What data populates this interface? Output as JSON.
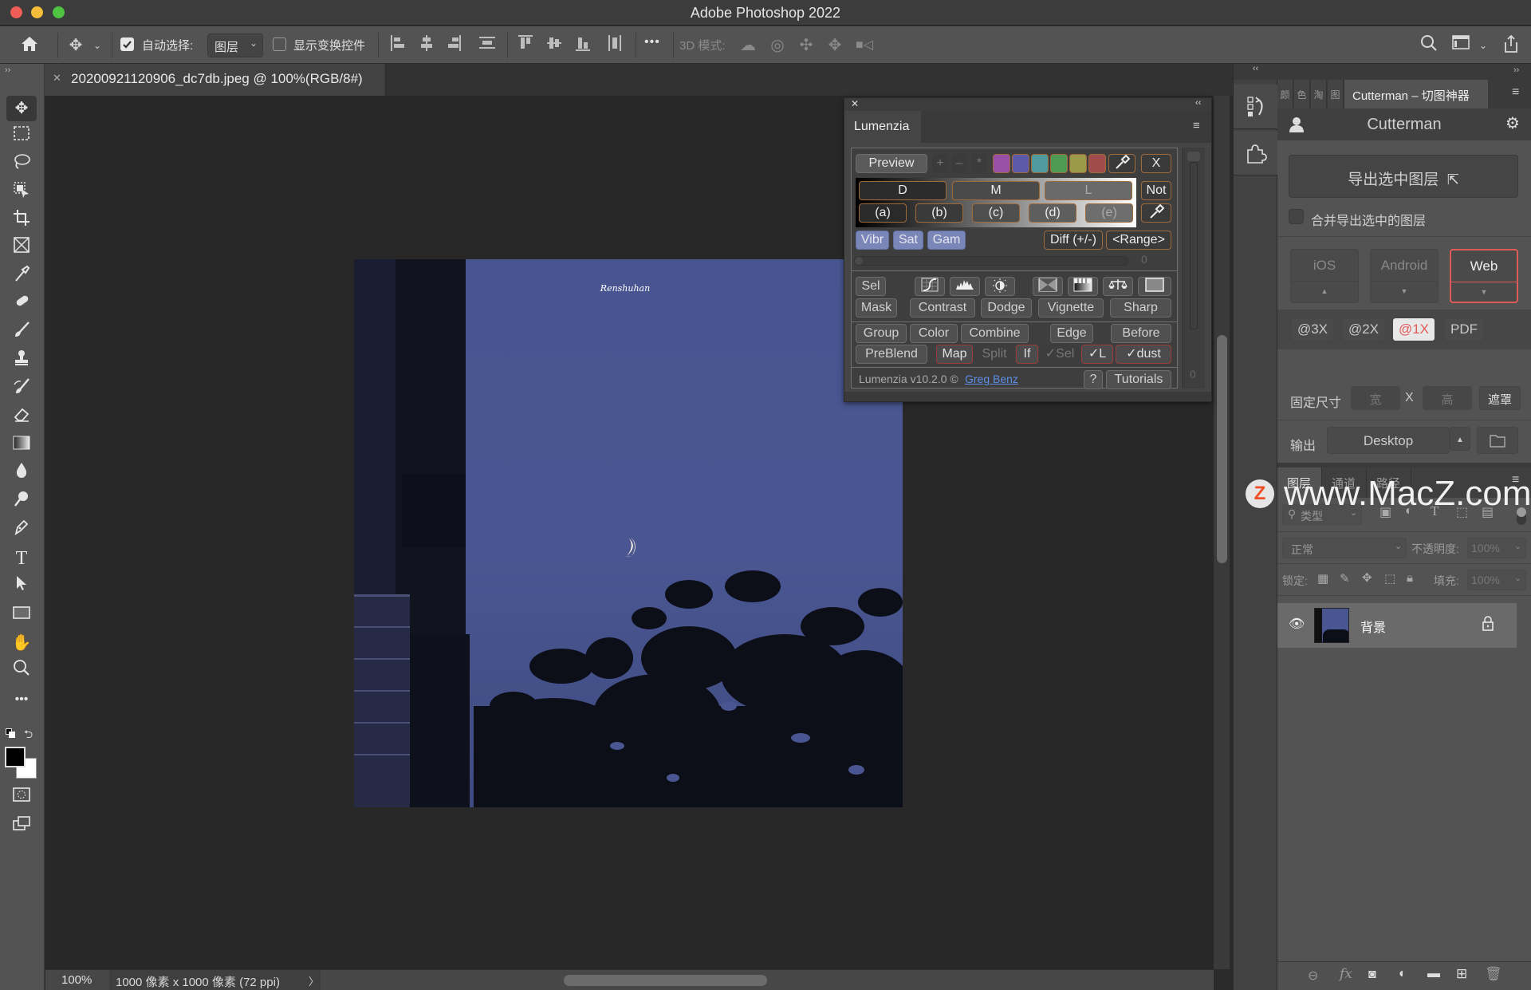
{
  "window": {
    "title": "Adobe Photoshop 2022"
  },
  "options_bar": {
    "auto_select_label": "自动选择:",
    "auto_select_checked": true,
    "auto_select_target": "图层",
    "show_transform_label": "显示变换控件",
    "show_transform_checked": false,
    "mode_3d_label": "3D 模式:",
    "more_label": "•••"
  },
  "document": {
    "tab_title": "20200921120906_dc7db.jpeg @ 100%(RGB/8#)",
    "watermark_signature": "Renshuhan"
  },
  "status_bar": {
    "zoom": "100%",
    "doc_info": "1000 像素 x 1000 像素 (72 ppi)",
    "arrow": "〉"
  },
  "toolbox": {
    "tools": [
      "move",
      "marquee",
      "lasso",
      "object-select",
      "crop",
      "frame",
      "eyedropper",
      "healing-brush",
      "brush",
      "clone-stamp",
      "history-brush",
      "eraser",
      "gradient",
      "blur",
      "dodge",
      "pen",
      "type",
      "path-select",
      "rectangle",
      "hand",
      "zoom",
      "more"
    ],
    "foreground_color": "#000000",
    "background_color": "#ffffff"
  },
  "lumenzia": {
    "tab": "Lumenzia",
    "preview": "Preview",
    "plus": "+",
    "minus": "–",
    "star": "*",
    "swatches": [
      "#9a4fa6",
      "#5b59a8",
      "#4e9a9c",
      "#4e9a54",
      "#9a9a4a",
      "#a04c4c"
    ],
    "x": "X",
    "tones": [
      "D",
      "M",
      "L"
    ],
    "not": "Not",
    "zones": [
      "(a)",
      "(b)",
      "(c)",
      "(d)",
      "(e)"
    ],
    "vibr": "Vibr",
    "sat": "Sat",
    "gam": "Gam",
    "diff": "Diff (+/-)",
    "range": "<Range>",
    "slider_value": "0",
    "sel": "Sel",
    "mask": "Mask",
    "adjust_icons": [
      "curves",
      "levels",
      "exposure",
      "solid-fill",
      "gradient-map",
      "color-balance",
      "solid-color"
    ],
    "row_actions": [
      "Contrast",
      "Dodge",
      "Vignette",
      "Sharp"
    ],
    "group": "Group",
    "color": "Color",
    "combine": "Combine",
    "edge": "Edge",
    "before": "Before",
    "preblend": "PreBlend",
    "map": "Map",
    "split": "Split",
    "if": "If",
    "check_sel": "✓Sel",
    "check_l": "✓L",
    "check_dust": "✓dust",
    "version": "Lumenzia v10.2.0 ©",
    "author": "Greg Benz",
    "help": "?",
    "tutorials": "Tutorials",
    "scroll_value": "0"
  },
  "right_panel": {
    "side_tabs": [
      "颜",
      "色",
      "淘",
      "图"
    ],
    "active_tab": "Cutterman – 切图神器",
    "cutterman_title": "Cutterman",
    "export_button": "导出选中图层",
    "merge_label": "合并导出选中的图层",
    "merge_checked": false,
    "platforms": [
      {
        "label": "iOS",
        "arrow": "▲",
        "selected": false
      },
      {
        "label": "Android",
        "arrow": "▼",
        "selected": false
      },
      {
        "label": "Web",
        "arrow": "▼",
        "selected": true
      }
    ],
    "scales": [
      {
        "label": "@3X",
        "selected": false
      },
      {
        "label": "@2X",
        "selected": false
      },
      {
        "label": "@1X",
        "selected": true
      },
      {
        "label": "PDF",
        "selected": false
      }
    ],
    "fixed_size_label": "固定尺寸",
    "width_placeholder": "宽",
    "x_label": "X",
    "height_placeholder": "高",
    "mask_button": "遮罩",
    "output_label": "输出",
    "output_value": "Desktop",
    "accent_color": "#e05a5a"
  },
  "layers_panel": {
    "tabs": [
      "图层",
      "通道",
      "路径"
    ],
    "filter_placeholder": "类型",
    "blend_mode": "正常",
    "opacity_label": "不透明度:",
    "opacity_value": "100%",
    "lock_label": "锁定:",
    "fill_label": "填充:",
    "fill_value": "100%",
    "layers": [
      {
        "name": "背景",
        "visible": true,
        "locked": true
      }
    ]
  },
  "watermark": {
    "text": "www.MacZ.com",
    "logo": "Z"
  }
}
